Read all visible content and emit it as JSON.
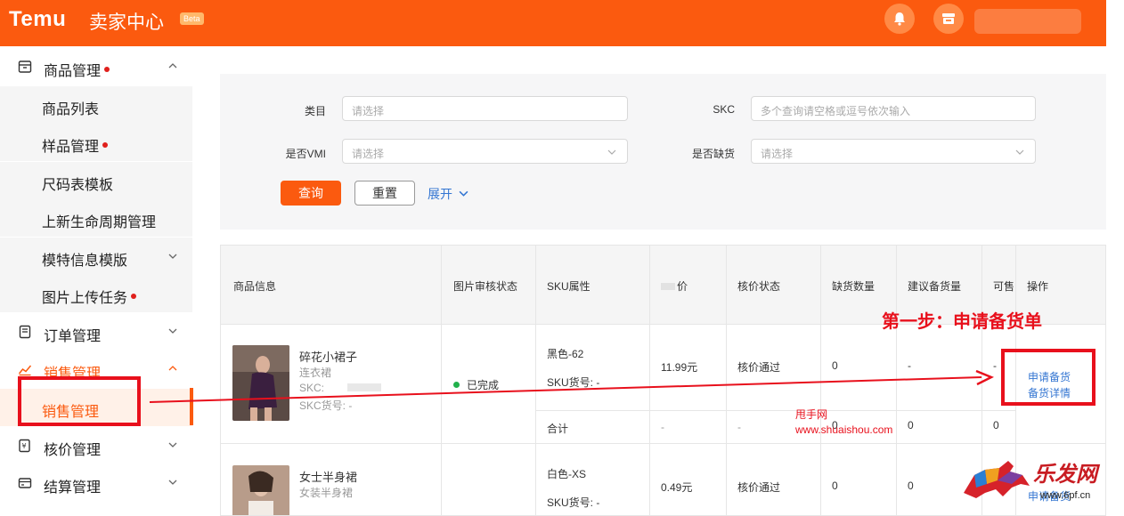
{
  "header": {
    "brand": "Temu",
    "title": "卖家中心",
    "badge": "Beta",
    "bell_icon": "bell-icon",
    "store_icon": "store-icon"
  },
  "sidebar": {
    "groups": [
      {
        "label": "商品管理",
        "icon": "box-icon",
        "dot": true,
        "expanded": true
      },
      {
        "label": "订单管理",
        "icon": "order-icon",
        "expanded": false
      },
      {
        "label": "销售管理",
        "icon": "sales-chart-icon",
        "expanded": true,
        "active": true
      },
      {
        "label": "核价管理",
        "icon": "price-check-icon",
        "expanded": false
      },
      {
        "label": "结算管理",
        "icon": "settlement-icon",
        "expanded": false
      }
    ],
    "product_items": [
      {
        "label": "商品列表"
      },
      {
        "label": "样品管理",
        "dot": true
      },
      {
        "label": "尺码表模板"
      },
      {
        "label": "上新生命周期管理"
      },
      {
        "label": "模特信息模版",
        "has_children": true
      },
      {
        "label": "图片上传任务",
        "dot": true
      }
    ],
    "sales_items": [
      {
        "label": "销售管理",
        "active": true
      }
    ]
  },
  "filter": {
    "category_label": "类目",
    "category_placeholder": "请选择",
    "skc_label": "SKC",
    "skc_placeholder": "多个查询请空格或逗号依次输入",
    "vmi_label": "是否VMI",
    "vmi_placeholder": "请选择",
    "shortage_label": "是否缺货",
    "shortage_placeholder": "请选择",
    "query_button": "查询",
    "reset_button": "重置",
    "expand_button": "展开"
  },
  "table": {
    "columns": [
      "商品信息",
      "图片审核状态",
      "SKU属性",
      "价",
      "核价状态",
      "缺货数量",
      "建议备货量",
      "可售",
      "操作"
    ],
    "rows": [
      {
        "product_name": "碎花小裙子",
        "product_category": "连衣裙",
        "skc_label": "SKC:",
        "skc_no_label": "SKC货号: -",
        "image_status": "已完成",
        "sku_attr": "黑色-62",
        "sku_no": "SKU货号: -",
        "price": "11.99元",
        "price_status": "核价通过",
        "shortage": "0",
        "suggested": "-",
        "available": "-",
        "action_apply": "申请备货",
        "action_detail": "备货详情",
        "total_label": "合计",
        "total_price": "-",
        "total_status": "-",
        "total_shortage": "0",
        "total_suggested": "0",
        "total_available": "0"
      },
      {
        "product_name": "女士半身裙",
        "product_category": "女装半身裙",
        "sku_attr": "白色-XS",
        "sku_no": "SKU货号: -",
        "price": "0.49元",
        "price_status": "核价通过",
        "shortage": "0",
        "suggested": "0",
        "action_apply": "申请备货"
      }
    ]
  },
  "annotations": {
    "step_label": "第一步：申请备货单",
    "watermark_name": "甩手网",
    "watermark_url": "www.shuaishou.com",
    "logo_text": "乐发网",
    "logo_url": "www.6pf.cn"
  },
  "colors": {
    "brand_orange": "#fb5a0f",
    "annotation_red": "#e8101c",
    "link_blue": "#3476d2",
    "status_green": "#22b14c"
  }
}
